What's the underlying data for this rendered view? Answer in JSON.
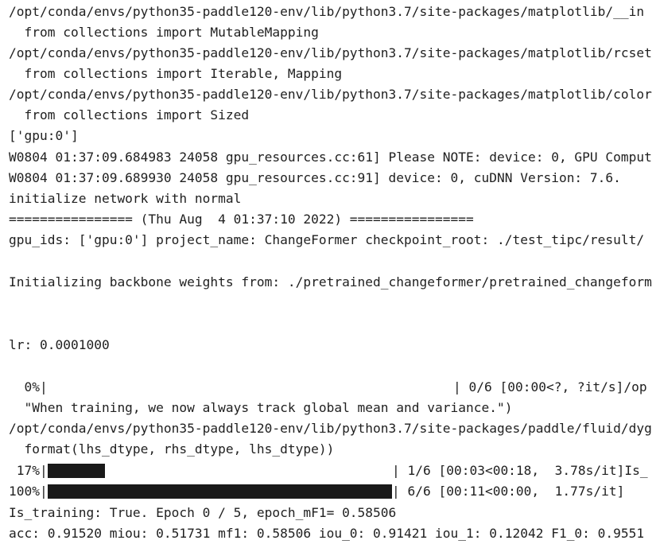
{
  "output": {
    "lines": [
      "/opt/conda/envs/python35-paddle120-env/lib/python3.7/site-packages/matplotlib/__in",
      "  from collections import MutableMapping",
      "/opt/conda/envs/python35-paddle120-env/lib/python3.7/site-packages/matplotlib/rcset",
      "  from collections import Iterable, Mapping",
      "/opt/conda/envs/python35-paddle120-env/lib/python3.7/site-packages/matplotlib/color",
      "  from collections import Sized",
      "['gpu:0']",
      "W0804 01:37:09.684983 24058 gpu_resources.cc:61] Please NOTE: device: 0, GPU Comput",
      "W0804 01:37:09.689930 24058 gpu_resources.cc:91] device: 0, cuDNN Version: 7.6.",
      "initialize network with normal",
      "================ (Thu Aug  4 01:37:10 2022) ================",
      "gpu_ids: ['gpu:0'] project_name: ChangeFormer checkpoint_root: ./test_tipc/result/",
      "Initializing backbone weights from: ./pretrained_changeformer/pretrained_changeform",
      "lr: 0.0001000",
      "  0%|",
      "| 0/6 [00:00<?, ?it/s]/op",
      "  \"When training, we now always track global mean and variance.\")",
      "/opt/conda/envs/python35-paddle120-env/lib/python3.7/site-packages/paddle/fluid/dyg",
      "  format(lhs_dtype, rhs_dtype, lhs_dtype))",
      " 17%|",
      "| 1/6 [00:03<00:18,  3.78s/it]Is_",
      "100%|",
      "| 6/6 [00:11<00:00,  1.77s/it]",
      "Is_training: True. Epoch 0 / 5, epoch_mF1= 0.58506",
      "acc: 0.91520 miou: 0.51731 mf1: 0.58506 iou_0: 0.91421 iou_1: 0.12042 F1_0: 0.9551"
    ]
  },
  "progress": {
    "p0": 0.0,
    "p17": 0.1667,
    "p100": 1.0
  },
  "colors": {
    "text": "#212121",
    "bar": "#1a1a1a",
    "background": "#ffffff"
  }
}
